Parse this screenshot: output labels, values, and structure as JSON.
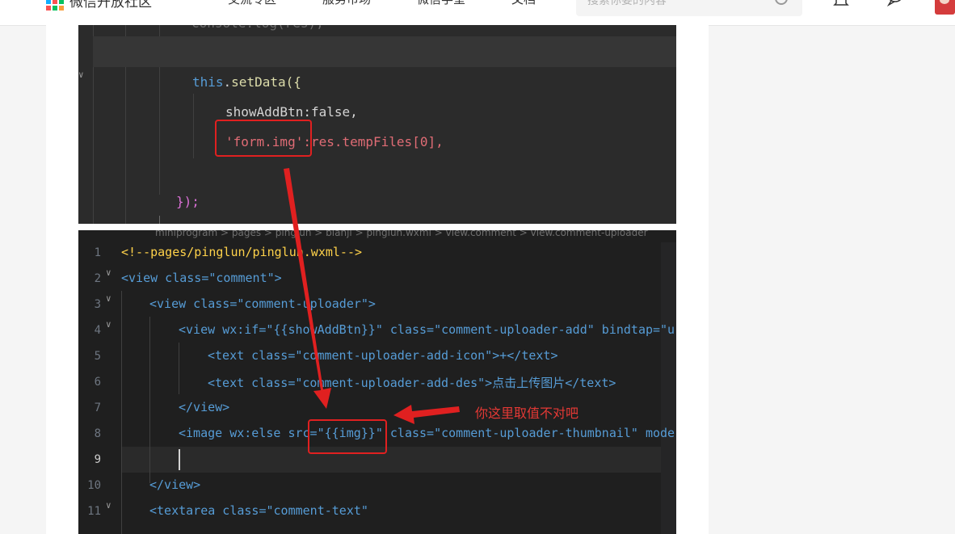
{
  "header": {
    "brand": "微信开放社区",
    "nav": [
      "交流专区",
      "服务市场",
      "微信学堂",
      "文档"
    ],
    "search_placeholder": "搜索你要的内容"
  },
  "editor_top": {
    "lines": {
      "l1": "setData({",
      "l2": "showAddBtn:false,",
      "l3": "'form.img':res.tempFiles[0],",
      "l4": "});"
    }
  },
  "editor_bottom": {
    "breadcrumb": "miniprogram > pages > pinglun > bianji > pinglun.wxml > view.comment > view.comment-uploader",
    "line_numbers": [
      "1",
      "2",
      "3",
      "4",
      "5",
      "6",
      "7",
      "8",
      "9",
      "10",
      "11"
    ],
    "lines": [
      "<!--pages/pinglun/pinglun.wxml-->",
      "<view class=\"comment\">",
      "<view class=\"comment-uploader\">",
      "<view wx:if=\"{{showAddBtn}}\" class=\"comment-uploader-add\" bindtap=\"u",
      "<text class=\"comment-uploader-add-icon\">+</text>",
      "<text class=\"comment-uploader-add-des\">点击上传图片</text>",
      "</view>",
      "<image wx:else src=\"{{img}}\" class=\"comment-uploader-thumbnail\" mode",
      "",
      "</view>",
      "<textarea class=\"comment-text\""
    ]
  },
  "annotation": {
    "note": "你这里取值不对吧",
    "color": "#e53935"
  },
  "colors": {
    "editor_bg": "#2b2b2b",
    "keyword": "#569cd6",
    "string": "#ce9178",
    "attribute": "#9cdcfe"
  }
}
